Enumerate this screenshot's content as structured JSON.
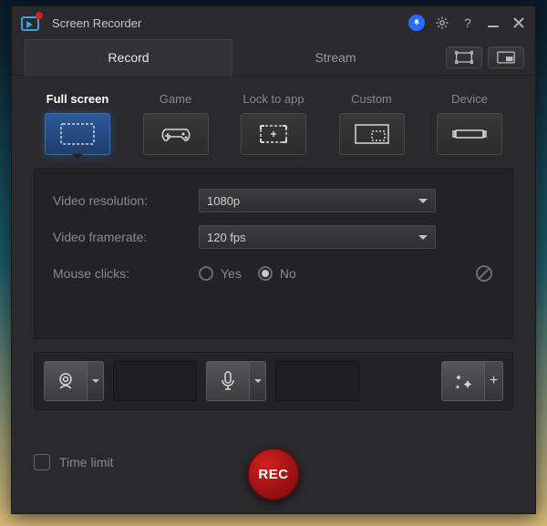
{
  "app": {
    "title": "Screen Recorder"
  },
  "titlebar_icons": [
    "bell",
    "gear",
    "help",
    "minimize",
    "close"
  ],
  "tabs": {
    "record": "Record",
    "stream": "Stream",
    "active": "record"
  },
  "modes": [
    {
      "id": "fullscreen",
      "label": "Full screen",
      "active": true
    },
    {
      "id": "game",
      "label": "Game"
    },
    {
      "id": "lock",
      "label": "Lock to app"
    },
    {
      "id": "custom",
      "label": "Custom"
    },
    {
      "id": "device",
      "label": "Device"
    }
  ],
  "settings": {
    "resolution_label": "Video resolution:",
    "resolution_value": "1080p",
    "framerate_label": "Video framerate:",
    "framerate_value": "120 fps",
    "mouse_label": "Mouse clicks:",
    "mouse_yes": "Yes",
    "mouse_no": "No",
    "mouse_selected": "no"
  },
  "footer": {
    "timelimit_label": "Time limit",
    "timelimit_checked": false,
    "rec_label": "REC"
  },
  "strip": {
    "webcam": "webcam",
    "mic": "mic",
    "effects": "effects"
  }
}
